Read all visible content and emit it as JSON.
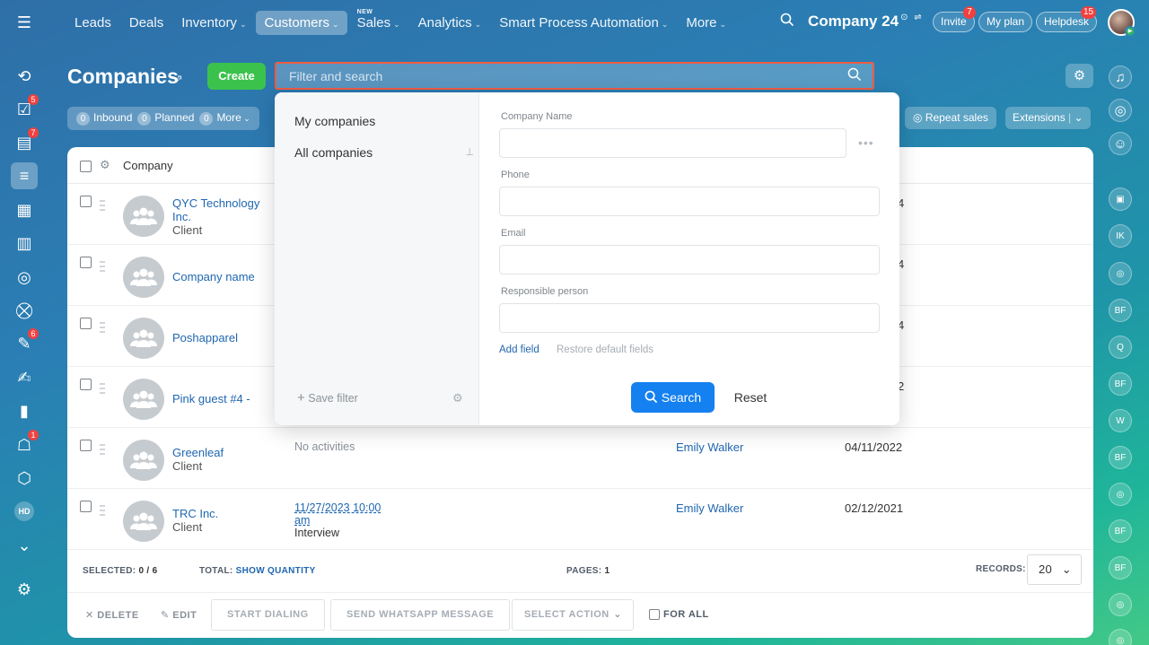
{
  "nav": {
    "items": [
      {
        "label": "Leads",
        "chevron": false,
        "active": false
      },
      {
        "label": "Deals",
        "chevron": false,
        "active": false
      },
      {
        "label": "Inventory",
        "chevron": true,
        "active": false
      },
      {
        "label": "Customers",
        "chevron": true,
        "active": true
      },
      {
        "label": "Sales",
        "chevron": true,
        "active": false,
        "tag": "NEW"
      },
      {
        "label": "Analytics",
        "chevron": true,
        "active": false
      },
      {
        "label": "Smart Process Automation",
        "chevron": true,
        "active": false
      },
      {
        "label": "More",
        "chevron": true,
        "active": false
      }
    ],
    "brand": "Company 24",
    "invite": "Invite",
    "invite_badge": "7",
    "my_plan": "My plan",
    "helpdesk": "Helpdesk",
    "helpdesk_badge": "15"
  },
  "left_sidebar": {
    "badges": {
      "tasks": "5",
      "feed": "7",
      "forms": "6",
      "robots": "1"
    },
    "hd_label": "HD"
  },
  "right_sidebar": [
    "BF",
    "IK",
    "BF",
    "Q",
    "BF",
    "W",
    "BF",
    "BF",
    "BF"
  ],
  "header": {
    "title": "Companies",
    "create": "Create",
    "search_placeholder": "Filter and search"
  },
  "counters": {
    "inbound_count": "0",
    "inbound": "Inbound",
    "planned_count": "0",
    "planned": "Planned",
    "more_count": "0",
    "more": "More"
  },
  "toolbar": {
    "repeat_sales": "Repeat sales",
    "extensions": "Extensions"
  },
  "grid": {
    "column_company": "Company",
    "rows": [
      {
        "name": "QYC Technology Inc.",
        "type": "Client",
        "activity": "",
        "activity_note": "",
        "responsible": "",
        "date": "4"
      },
      {
        "name": "Company name",
        "type": "",
        "activity": "",
        "activity_note": "",
        "responsible": "",
        "date": "4"
      },
      {
        "name": "Poshapparel",
        "type": "",
        "activity": "",
        "activity_note": "",
        "responsible": "",
        "date": "4"
      },
      {
        "name": "Pink guest #4 -",
        "type": "",
        "activity": "",
        "activity_note": "",
        "responsible": "",
        "date": "2"
      },
      {
        "name": "Greenleaf",
        "type": "Client",
        "activity": "No activities",
        "activity_note": "",
        "responsible": "Emily Walker",
        "date": "04/11/2022"
      },
      {
        "name": "TRC Inc.",
        "type": "Client",
        "activity": "11/27/2023 10:00 am",
        "activity_note": "Interview",
        "responsible": "Emily Walker",
        "date": "02/12/2021"
      }
    ]
  },
  "footer": {
    "selected_label": "SELECTED:",
    "selected_value": "0 / 6",
    "total_label": "TOTAL:",
    "total_value": "SHOW QUANTITY",
    "pages_label": "PAGES:",
    "pages_value": "1",
    "records_label": "RECORDS:",
    "records_value": "20",
    "delete": "DELETE",
    "edit": "EDIT",
    "start_dialing": "START DIALING",
    "send_whatsapp": "SEND WHATSAPP MESSAGE",
    "select_action": "SELECT ACTION",
    "for_all": "FOR ALL"
  },
  "filter_panel": {
    "presets": [
      "My companies",
      "All companies"
    ],
    "save_filter": "Save filter",
    "fields": [
      {
        "label": "Company Name",
        "value": ""
      },
      {
        "label": "Phone",
        "value": ""
      },
      {
        "label": "Email",
        "value": ""
      },
      {
        "label": "Responsible person",
        "value": ""
      }
    ],
    "add_field": "Add field",
    "restore_default": "Restore default fields",
    "search": "Search",
    "reset": "Reset"
  }
}
